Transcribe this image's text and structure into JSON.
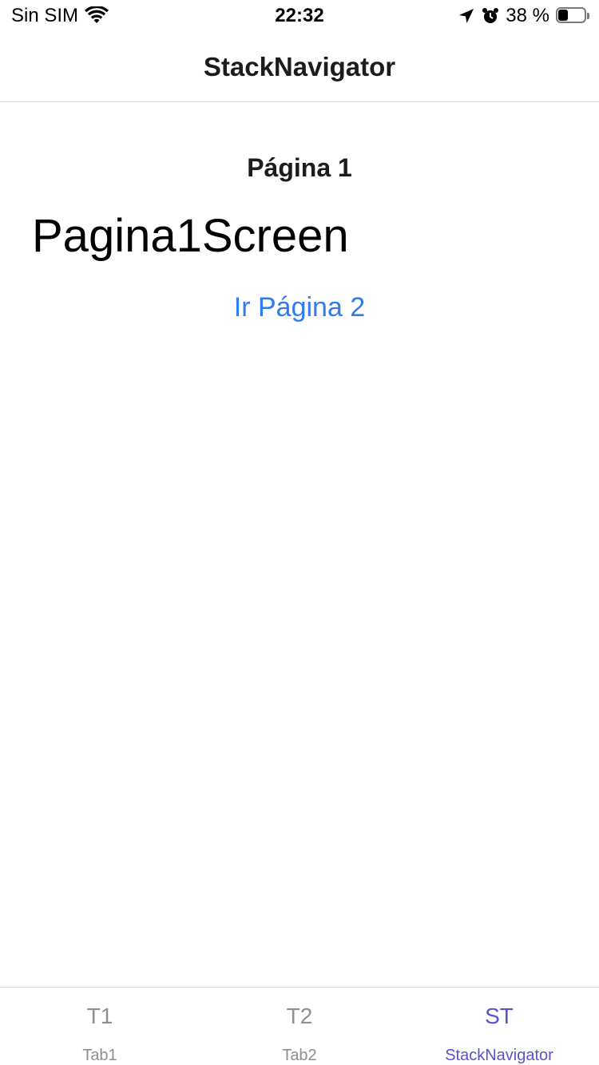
{
  "status_bar": {
    "carrier": "Sin SIM",
    "time": "22:32",
    "battery_text": "38 %",
    "battery_level": 0.38,
    "icons": [
      "wifi-icon",
      "location-arrow-icon",
      "alarm-clock-icon",
      "battery-icon"
    ]
  },
  "header": {
    "title": "StackNavigator"
  },
  "main": {
    "page_heading": "Página 1",
    "screen_name": "Pagina1Screen",
    "go_button_label": "Ir Página 2"
  },
  "tabs": [
    {
      "icon_text": "T1",
      "label": "Tab1",
      "active": false
    },
    {
      "icon_text": "T2",
      "label": "Tab2",
      "active": false
    },
    {
      "icon_text": "ST",
      "label": "StackNavigator",
      "active": true
    }
  ],
  "colors": {
    "link": "#2f7bef",
    "tab_active": "#5b52c7",
    "tab_inactive": "#8e8e93"
  }
}
